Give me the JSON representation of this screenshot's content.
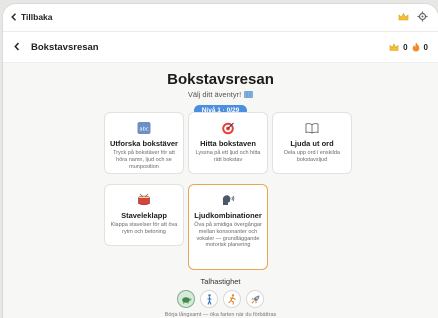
{
  "topbar": {
    "back_label": "Tillbaka",
    "icons": [
      "crown-icon",
      "gear-icon"
    ]
  },
  "header": {
    "title": "Bokstavsresan",
    "stars": "0",
    "flames": "0"
  },
  "hero": {
    "title": "Bokstavsresan",
    "subtitle": "Välj ditt äventyr!",
    "level": "Nivå 1 · 0/29"
  },
  "cards": [
    {
      "title": "Utforska bokstäver",
      "desc": "Tryck på bokstäver för att höra namn, ljud och se munposition",
      "icon": "abc-icon"
    },
    {
      "title": "Hitta bokstaven",
      "desc": "Lyssna på ett ljud och hitta rätt bokstav",
      "icon": "target-icon"
    },
    {
      "title": "Ljuda ut ord",
      "desc": "Dela upp ord i enskilda bokstavsljud",
      "icon": "book-icon"
    },
    {
      "title": "Staveleklapp",
      "desc": "Klappa stavelser för att öva rytm och betoning",
      "icon": "drum-icon"
    },
    {
      "title": "Ljudkombinationer",
      "desc": "Öva på smidiga övergångar mellan konsonanter och vokaler — grundläggande motorisk planering",
      "icon": "speaking-head-icon"
    }
  ],
  "speed": {
    "label": "Talhastighet",
    "hint": "Börja långsamt — öka farten när du förbättras",
    "options": [
      "turtle-icon",
      "walker-icon",
      "runner-icon",
      "rocket-icon"
    ],
    "active": "turtle-icon"
  },
  "colors": {
    "accent": "#4a8fe0",
    "selected_border": "#e4a657",
    "active_speed": "#d6e9da"
  }
}
